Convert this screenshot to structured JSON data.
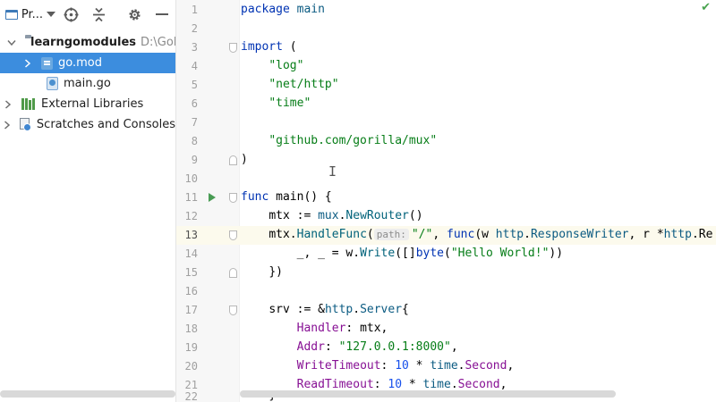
{
  "panel": {
    "title": "Pr...",
    "tree": [
      {
        "label": "learngomodules",
        "path": "D:\\GoLa",
        "bold": true
      },
      {
        "label": "go.mod",
        "selected": true
      },
      {
        "label": "main.go"
      },
      {
        "label": "External Libraries"
      },
      {
        "label": "Scratches and Consoles"
      }
    ]
  },
  "editor": {
    "line_numbers": [
      "1",
      "2",
      "3",
      "4",
      "5",
      "6",
      "7",
      "8",
      "9",
      "10",
      "11",
      "12",
      "13",
      "14",
      "15",
      "16",
      "17",
      "18",
      "19",
      "20",
      "21",
      "22"
    ],
    "current_line": 13,
    "param_hint": "path:",
    "l1": {
      "kw": "package",
      "name": " main"
    },
    "l3": {
      "kw": "import",
      "rest": " ("
    },
    "l4": "\"log\"",
    "l5": "\"net/http\"",
    "l6": "\"time\"",
    "l8": "\"github.com/gorilla/mux\"",
    "l9": ")",
    "l11": {
      "kw": "func",
      "rest": " main() {"
    },
    "l12": {
      "a": "mtx := ",
      "pkg": "mux",
      "dot": ".",
      "fn": "NewRouter",
      "b": "()"
    },
    "l13": {
      "a": "mtx.",
      "fn": "HandleFunc",
      "b": "(",
      "str": "\"/\"",
      "c": ", ",
      "kw": "func",
      "d": "(w ",
      "pkg1": "http",
      "e": ".",
      "t1": "ResponseWriter",
      "f": ", r *",
      "pkg2": "http",
      "g": ".Re"
    },
    "l14": {
      "a": "_, _ = w.",
      "fn": "Write",
      "b": "([]",
      "kw": "byte",
      "c": "(",
      "str": "\"Hello World!\"",
      "d": "))"
    },
    "l15": "})",
    "l17": {
      "a": "srv := &",
      "pkg": "http",
      "dot": ".",
      "t": "Server",
      "b": "{"
    },
    "l18": {
      "fld": "Handler",
      "b": ": mtx,"
    },
    "l19": {
      "fld": "Addr",
      "b": ": ",
      "str": "\"127.0.0.1:8000\"",
      "c": ","
    },
    "l20": {
      "fld": "WriteTimeout",
      "b": ": ",
      "num": "10",
      "c": " * ",
      "pkg": "time",
      "dot": ".",
      "fld2": "Second",
      "d": ","
    },
    "l21": {
      "fld": "ReadTimeout",
      "b": ": ",
      "num": "10",
      "c": " * ",
      "pkg": "time",
      "dot": ".",
      "fld2": "Second",
      "d": ","
    },
    "l22": "}"
  }
}
